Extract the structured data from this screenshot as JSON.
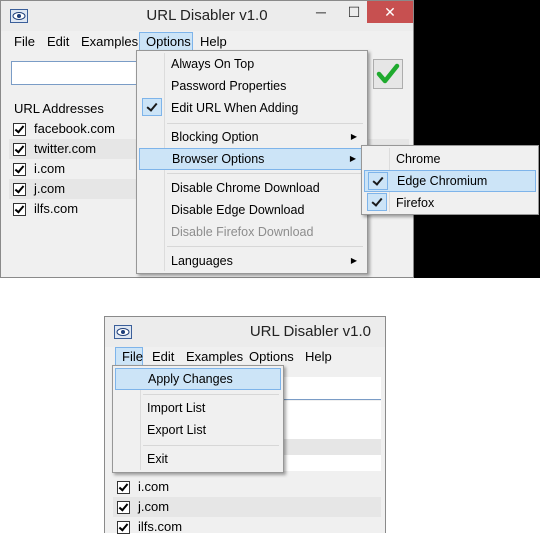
{
  "window1": {
    "title": "URL Disabler v1.0",
    "controls": {
      "minimize": "─",
      "maximize": "☐",
      "close": "✕"
    },
    "menu": [
      "File",
      "Edit",
      "Examples",
      "Options",
      "Help"
    ],
    "active_menu": "Options",
    "list_header": "URL Addresses",
    "urls": [
      "facebook.com",
      "twitter.com",
      "i.com",
      "j.com",
      "ilfs.com"
    ],
    "options_menu": {
      "always_on_top": "Always On Top",
      "password_properties": "Password Properties",
      "edit_url_when_adding": "Edit URL When Adding",
      "blocking_option": "Blocking Option",
      "browser_options": "Browser Options",
      "disable_chrome_download": "Disable Chrome Download",
      "disable_edge_download": "Disable Edge Download",
      "disable_firefox_download": "Disable Firefox Download",
      "languages": "Languages"
    },
    "browser_submenu": {
      "chrome": "Chrome",
      "edge_chromium": "Edge Chromium",
      "firefox": "Firefox"
    }
  },
  "window2": {
    "title": "URL Disabler v1.0",
    "menu": [
      "File",
      "Edit",
      "Examples",
      "Options",
      "Help"
    ],
    "active_menu": "File",
    "file_menu": {
      "apply_changes": "Apply Changes",
      "import_list": "Import List",
      "export_list": "Export List",
      "exit": "Exit"
    },
    "urls": [
      "i.com",
      "j.com",
      "ilfs.com"
    ]
  },
  "icons": {
    "app": "eye-icon",
    "ok": "green-check-icon",
    "submenu": "chevron-right-icon",
    "checkbox": "checkbox-icon"
  },
  "colors": {
    "highlight": "#cce4f7",
    "highlight_border": "#7eb4ea",
    "close_button": "#c75050",
    "check_green": "#1faa2e"
  }
}
